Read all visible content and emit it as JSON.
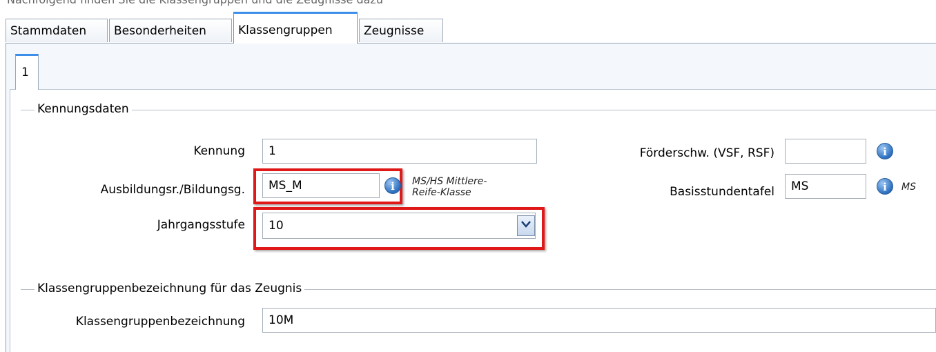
{
  "top_caption": "Nachfolgend finden Sie die Klassengruppen und die Zeugnisse dazu",
  "tabs": [
    {
      "label": "Stammdaten"
    },
    {
      "label": "Besonderheiten"
    },
    {
      "label": "Klassengruppen"
    },
    {
      "label": "Zeugnisse"
    }
  ],
  "subtab": {
    "label": "1"
  },
  "kennung_group": {
    "title": "Kennungsdaten",
    "kennung": {
      "label": "Kennung",
      "value": "1"
    },
    "ausbildung": {
      "label": "Ausbildungsr./Bildungsg.",
      "value": "MS_M",
      "note_line1": "MS/HS Mittlere-",
      "note_line2": "Reife-Klasse"
    },
    "jahrgang": {
      "label": "Jahrgangsstufe",
      "value": "10"
    },
    "foerder": {
      "label": "Förderschw. (VSF, RSF)",
      "value": ""
    },
    "basis": {
      "label": "Basisstundentafel",
      "value": "MS",
      "note": "MS"
    }
  },
  "zeugnis_group": {
    "title": "Klassengruppenbezeichnung für das Zeugnis",
    "bezeichnung": {
      "label": "Klassengruppenbezeichnung",
      "value": "10M"
    }
  },
  "colors": {
    "accent": "#3d8ee8",
    "highlight": "#e01818"
  },
  "icons": [
    "info-icon",
    "chevron-down-icon"
  ]
}
